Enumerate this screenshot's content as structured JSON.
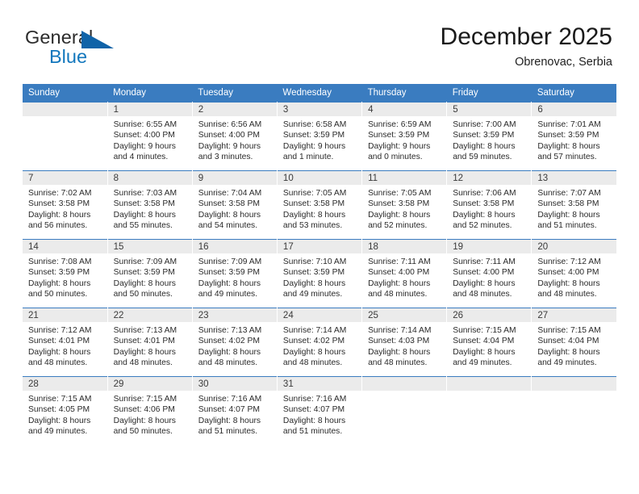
{
  "logo": {
    "word_one": "General",
    "word_two": "Blue",
    "triangle_color": "#1063a8",
    "word_two_color": "#1277bd",
    "icon": "general-blue-logo-triangle"
  },
  "header": {
    "title": "December 2025",
    "subtitle": "Obrenovac, Serbia"
  },
  "theme": {
    "header_bg": "#3a7cc0",
    "header_text": "#ffffff",
    "daynum_bg": "#ebebeb",
    "cell_bg": "#ffffff",
    "row_border": "#3a7cc0"
  },
  "calendar": {
    "weekdays": [
      "Sunday",
      "Monday",
      "Tuesday",
      "Wednesday",
      "Thursday",
      "Friday",
      "Saturday"
    ],
    "labels": {
      "sunrise": "Sunrise:",
      "sunset": "Sunset:",
      "daylight": "Daylight:"
    },
    "weeks": [
      [
        {
          "day": ""
        },
        {
          "day": "1",
          "sunrise": "Sunrise: 6:55 AM",
          "sunset": "Sunset: 4:00 PM",
          "daylight_1": "Daylight: 9 hours",
          "daylight_2": "and 4 minutes."
        },
        {
          "day": "2",
          "sunrise": "Sunrise: 6:56 AM",
          "sunset": "Sunset: 4:00 PM",
          "daylight_1": "Daylight: 9 hours",
          "daylight_2": "and 3 minutes."
        },
        {
          "day": "3",
          "sunrise": "Sunrise: 6:58 AM",
          "sunset": "Sunset: 3:59 PM",
          "daylight_1": "Daylight: 9 hours",
          "daylight_2": "and 1 minute."
        },
        {
          "day": "4",
          "sunrise": "Sunrise: 6:59 AM",
          "sunset": "Sunset: 3:59 PM",
          "daylight_1": "Daylight: 9 hours",
          "daylight_2": "and 0 minutes."
        },
        {
          "day": "5",
          "sunrise": "Sunrise: 7:00 AM",
          "sunset": "Sunset: 3:59 PM",
          "daylight_1": "Daylight: 8 hours",
          "daylight_2": "and 59 minutes."
        },
        {
          "day": "6",
          "sunrise": "Sunrise: 7:01 AM",
          "sunset": "Sunset: 3:59 PM",
          "daylight_1": "Daylight: 8 hours",
          "daylight_2": "and 57 minutes."
        }
      ],
      [
        {
          "day": "7",
          "sunrise": "Sunrise: 7:02 AM",
          "sunset": "Sunset: 3:58 PM",
          "daylight_1": "Daylight: 8 hours",
          "daylight_2": "and 56 minutes."
        },
        {
          "day": "8",
          "sunrise": "Sunrise: 7:03 AM",
          "sunset": "Sunset: 3:58 PM",
          "daylight_1": "Daylight: 8 hours",
          "daylight_2": "and 55 minutes."
        },
        {
          "day": "9",
          "sunrise": "Sunrise: 7:04 AM",
          "sunset": "Sunset: 3:58 PM",
          "daylight_1": "Daylight: 8 hours",
          "daylight_2": "and 54 minutes."
        },
        {
          "day": "10",
          "sunrise": "Sunrise: 7:05 AM",
          "sunset": "Sunset: 3:58 PM",
          "daylight_1": "Daylight: 8 hours",
          "daylight_2": "and 53 minutes."
        },
        {
          "day": "11",
          "sunrise": "Sunrise: 7:05 AM",
          "sunset": "Sunset: 3:58 PM",
          "daylight_1": "Daylight: 8 hours",
          "daylight_2": "and 52 minutes."
        },
        {
          "day": "12",
          "sunrise": "Sunrise: 7:06 AM",
          "sunset": "Sunset: 3:58 PM",
          "daylight_1": "Daylight: 8 hours",
          "daylight_2": "and 52 minutes."
        },
        {
          "day": "13",
          "sunrise": "Sunrise: 7:07 AM",
          "sunset": "Sunset: 3:58 PM",
          "daylight_1": "Daylight: 8 hours",
          "daylight_2": "and 51 minutes."
        }
      ],
      [
        {
          "day": "14",
          "sunrise": "Sunrise: 7:08 AM",
          "sunset": "Sunset: 3:59 PM",
          "daylight_1": "Daylight: 8 hours",
          "daylight_2": "and 50 minutes."
        },
        {
          "day": "15",
          "sunrise": "Sunrise: 7:09 AM",
          "sunset": "Sunset: 3:59 PM",
          "daylight_1": "Daylight: 8 hours",
          "daylight_2": "and 50 minutes."
        },
        {
          "day": "16",
          "sunrise": "Sunrise: 7:09 AM",
          "sunset": "Sunset: 3:59 PM",
          "daylight_1": "Daylight: 8 hours",
          "daylight_2": "and 49 minutes."
        },
        {
          "day": "17",
          "sunrise": "Sunrise: 7:10 AM",
          "sunset": "Sunset: 3:59 PM",
          "daylight_1": "Daylight: 8 hours",
          "daylight_2": "and 49 minutes."
        },
        {
          "day": "18",
          "sunrise": "Sunrise: 7:11 AM",
          "sunset": "Sunset: 4:00 PM",
          "daylight_1": "Daylight: 8 hours",
          "daylight_2": "and 48 minutes."
        },
        {
          "day": "19",
          "sunrise": "Sunrise: 7:11 AM",
          "sunset": "Sunset: 4:00 PM",
          "daylight_1": "Daylight: 8 hours",
          "daylight_2": "and 48 minutes."
        },
        {
          "day": "20",
          "sunrise": "Sunrise: 7:12 AM",
          "sunset": "Sunset: 4:00 PM",
          "daylight_1": "Daylight: 8 hours",
          "daylight_2": "and 48 minutes."
        }
      ],
      [
        {
          "day": "21",
          "sunrise": "Sunrise: 7:12 AM",
          "sunset": "Sunset: 4:01 PM",
          "daylight_1": "Daylight: 8 hours",
          "daylight_2": "and 48 minutes."
        },
        {
          "day": "22",
          "sunrise": "Sunrise: 7:13 AM",
          "sunset": "Sunset: 4:01 PM",
          "daylight_1": "Daylight: 8 hours",
          "daylight_2": "and 48 minutes."
        },
        {
          "day": "23",
          "sunrise": "Sunrise: 7:13 AM",
          "sunset": "Sunset: 4:02 PM",
          "daylight_1": "Daylight: 8 hours",
          "daylight_2": "and 48 minutes."
        },
        {
          "day": "24",
          "sunrise": "Sunrise: 7:14 AM",
          "sunset": "Sunset: 4:02 PM",
          "daylight_1": "Daylight: 8 hours",
          "daylight_2": "and 48 minutes."
        },
        {
          "day": "25",
          "sunrise": "Sunrise: 7:14 AM",
          "sunset": "Sunset: 4:03 PM",
          "daylight_1": "Daylight: 8 hours",
          "daylight_2": "and 48 minutes."
        },
        {
          "day": "26",
          "sunrise": "Sunrise: 7:15 AM",
          "sunset": "Sunset: 4:04 PM",
          "daylight_1": "Daylight: 8 hours",
          "daylight_2": "and 49 minutes."
        },
        {
          "day": "27",
          "sunrise": "Sunrise: 7:15 AM",
          "sunset": "Sunset: 4:04 PM",
          "daylight_1": "Daylight: 8 hours",
          "daylight_2": "and 49 minutes."
        }
      ],
      [
        {
          "day": "28",
          "sunrise": "Sunrise: 7:15 AM",
          "sunset": "Sunset: 4:05 PM",
          "daylight_1": "Daylight: 8 hours",
          "daylight_2": "and 49 minutes."
        },
        {
          "day": "29",
          "sunrise": "Sunrise: 7:15 AM",
          "sunset": "Sunset: 4:06 PM",
          "daylight_1": "Daylight: 8 hours",
          "daylight_2": "and 50 minutes."
        },
        {
          "day": "30",
          "sunrise": "Sunrise: 7:16 AM",
          "sunset": "Sunset: 4:07 PM",
          "daylight_1": "Daylight: 8 hours",
          "daylight_2": "and 51 minutes."
        },
        {
          "day": "31",
          "sunrise": "Sunrise: 7:16 AM",
          "sunset": "Sunset: 4:07 PM",
          "daylight_1": "Daylight: 8 hours",
          "daylight_2": "and 51 minutes."
        },
        {
          "day": ""
        },
        {
          "day": ""
        },
        {
          "day": ""
        }
      ]
    ]
  }
}
